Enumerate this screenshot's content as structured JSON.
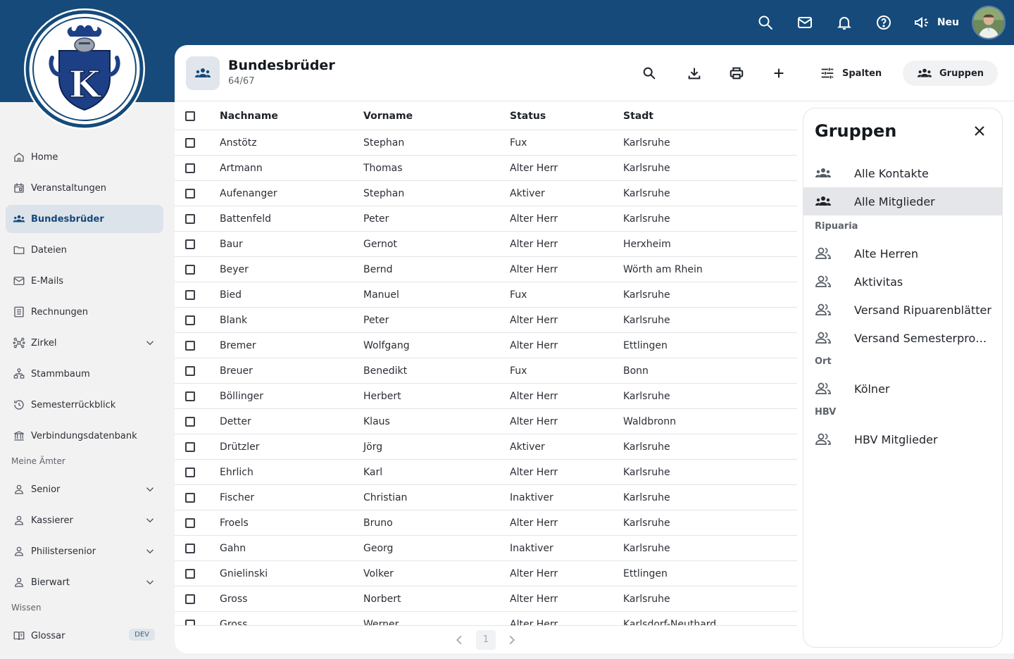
{
  "topbar": {
    "neu_label": "Neu"
  },
  "nav": {
    "items": [
      {
        "label": "Home"
      },
      {
        "label": "Veranstaltungen"
      },
      {
        "label": "Bundesbrüder"
      },
      {
        "label": "Dateien"
      },
      {
        "label": "E-Mails"
      },
      {
        "label": "Rechnungen"
      },
      {
        "label": "Zirkel"
      },
      {
        "label": "Stammbaum"
      },
      {
        "label": "Semesterrückblick"
      },
      {
        "label": "Verbindungsdatenbank"
      }
    ],
    "section_aemter": "Meine Ämter",
    "aemter": [
      {
        "label": "Senior"
      },
      {
        "label": "Kassierer"
      },
      {
        "label": "Philistersenior"
      },
      {
        "label": "Bierwart"
      }
    ],
    "section_wissen": "Wissen",
    "wissen": [
      {
        "label": "Glossar",
        "badge": "DEV"
      }
    ]
  },
  "header": {
    "title": "Bundesbrüder",
    "count": "64/67",
    "spalten_label": "Spalten",
    "gruppen_label": "Gruppen"
  },
  "table": {
    "columns": [
      "Nachname",
      "Vorname",
      "Status",
      "Stadt"
    ],
    "rows": [
      [
        "Anstötz",
        "Stephan",
        "Fux",
        "Karlsruhe"
      ],
      [
        "Artmann",
        "Thomas",
        "Alter Herr",
        "Karlsruhe"
      ],
      [
        "Aufenanger",
        "Stephan",
        "Aktiver",
        "Karlsruhe"
      ],
      [
        "Battenfeld",
        "Peter",
        "Alter Herr",
        "Karlsruhe"
      ],
      [
        "Baur",
        "Gernot",
        "Alter Herr",
        "Herxheim"
      ],
      [
        "Beyer",
        "Bernd",
        "Alter Herr",
        "Wörth am Rhein"
      ],
      [
        "Bied",
        "Manuel",
        "Fux",
        "Karlsruhe"
      ],
      [
        "Blank",
        "Peter",
        "Alter Herr",
        "Karlsruhe"
      ],
      [
        "Bremer",
        "Wolfgang",
        "Alter Herr",
        "Ettlingen"
      ],
      [
        "Breuer",
        "Benedikt",
        "Fux",
        "Bonn"
      ],
      [
        "Böllinger",
        "Herbert",
        "Alter Herr",
        "Karlsruhe"
      ],
      [
        "Detter",
        "Klaus",
        "Alter Herr",
        "Waldbronn"
      ],
      [
        "Drützler",
        "Jörg",
        "Aktiver",
        "Karlsruhe"
      ],
      [
        "Ehrlich",
        "Karl",
        "Alter Herr",
        "Karlsruhe"
      ],
      [
        "Fischer",
        "Christian",
        "Inaktiver",
        "Karlsruhe"
      ],
      [
        "Froels",
        "Bruno",
        "Alter Herr",
        "Karlsruhe"
      ],
      [
        "Gahn",
        "Georg",
        "Inaktiver",
        "Karlsruhe"
      ],
      [
        "Gnielinski",
        "Volker",
        "Alter Herr",
        "Ettlingen"
      ],
      [
        "Gross",
        "Norbert",
        "Alter Herr",
        "Karlsruhe"
      ],
      [
        "Gross",
        "Werner",
        "Alter Herr",
        "Karlsdorf-Neuthard"
      ]
    ]
  },
  "pager": {
    "current": "1"
  },
  "panel": {
    "title": "Gruppen",
    "top_items": [
      {
        "label": "Alle Kontakte"
      },
      {
        "label": "Alle Mitglieder"
      }
    ],
    "sections": [
      {
        "title": "Ripuaria",
        "items": [
          "Alte Herren",
          "Aktivitas",
          "Versand Ripuarenblätter",
          "Versand Semesterprogr…"
        ]
      },
      {
        "title": "Ort",
        "items": [
          "Kölner"
        ]
      },
      {
        "title": "HBV",
        "items": [
          "HBV Mitglieder"
        ]
      }
    ]
  }
}
